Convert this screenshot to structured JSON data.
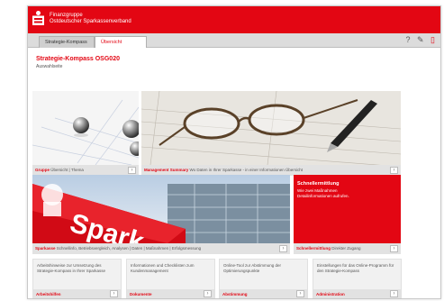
{
  "header": {
    "brand_line1": "Finanzgruppe",
    "brand_line2": "Ostdeutscher Sparkassenverband"
  },
  "tabs": [
    {
      "label": "Strategie-Kompass"
    },
    {
      "label": "Übersicht"
    }
  ],
  "toolbar": {
    "help_icon": "?",
    "settings_icon": "✎",
    "pdf_icon": "▯"
  },
  "page": {
    "title": "Strategie-Kompass OSG020",
    "subtitle": "Auswahlseite"
  },
  "tiles": {
    "gruppe": {
      "caption_bold": "Gruppe",
      "caption_text": " Übersicht | Thema"
    },
    "summary": {
      "caption_bold": "Management Summary",
      "caption_text": " Wo Daten in Ihrer Sparkasse - in einer Informationen Übersicht"
    },
    "sparkasse": {
      "caption_bold": "Sparkasse",
      "caption_text": " Schnellinfo, Betriebsvergleich, Analysen | Daten | Maßnahmen | Erfolgsmessung"
    },
    "schnell": {
      "title": "Schnellermittlung",
      "text": "Wie zwei Maßnahmen Detailinformationen aufrufen.",
      "caption_bold": "Schnellermittlung",
      "caption_text": " Direkter Zugang"
    }
  },
  "bottom": [
    {
      "text": "Arbeitshinweise zur Umsetzung des Strategie-Kompass in Ihrer Sparkasse",
      "label": "Arbeitshilfen"
    },
    {
      "text": "Informationen und Checklisten zum Kundenmanagement",
      "label": "Dokumente"
    },
    {
      "text": "Online-Tool zur Abstimmung der Optimierungspunkte",
      "label": "Abstimmung"
    },
    {
      "text": "Einstellungen für das Online-Programm für den Strategie-Kompass",
      "label": "Administration"
    }
  ],
  "colors": {
    "accent": "#e30613",
    "tile_caption": "#e2e2e2"
  }
}
